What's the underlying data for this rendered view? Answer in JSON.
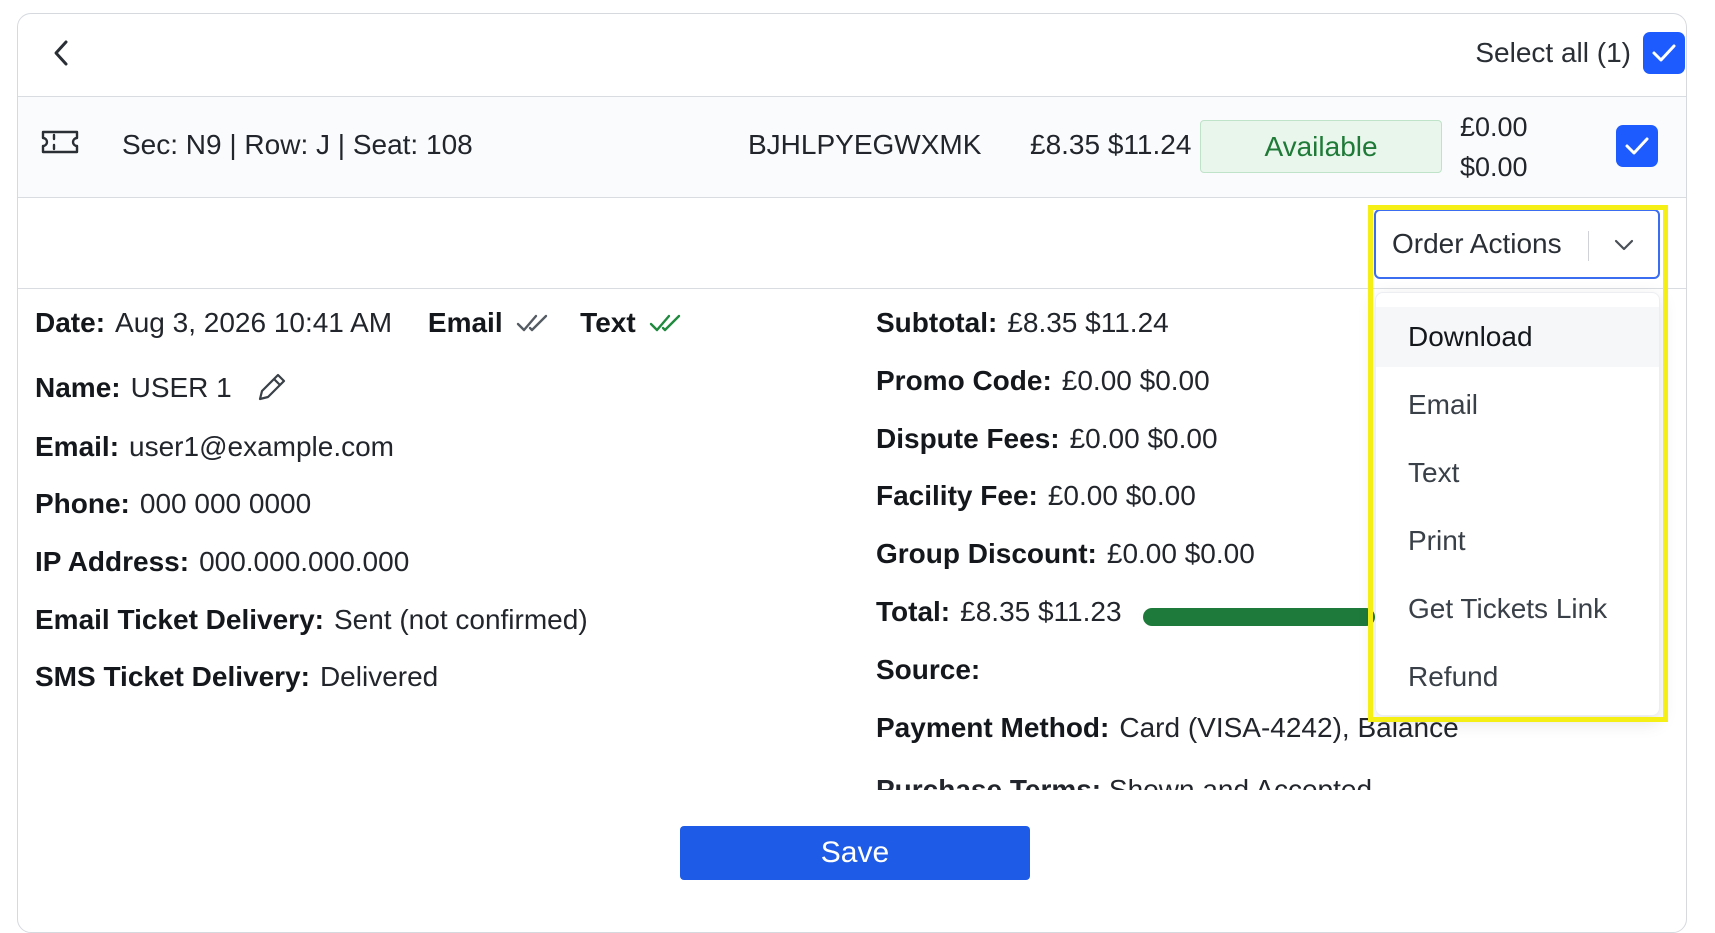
{
  "header": {
    "select_all_label": "Select all (1)"
  },
  "ticket": {
    "seat_info": "Sec: N9 | Row: J | Seat: 108",
    "order_code": "BJHLPYEGWXMK",
    "price": "£8.35 $11.24",
    "status": "Available",
    "fee_gbp": "£0.00",
    "fee_usd": "$0.00"
  },
  "order_actions": {
    "label": "Order Actions",
    "menu": [
      "Download",
      "Email",
      "Text",
      "Print",
      "Get Tickets Link",
      "Refund"
    ]
  },
  "details_left": {
    "date_label": "Date:",
    "date_value": "Aug 3, 2026 10:41 AM",
    "email_flag": "Email",
    "text_flag": "Text",
    "name_label": "Name:",
    "name_value": "USER 1",
    "email_label": "Email:",
    "email_value": "user1@example.com",
    "phone_label": "Phone:",
    "phone_value": "000 000 0000",
    "ip_label": "IP Address:",
    "ip_value": "000.000.000.000",
    "email_delivery_label": "Email Ticket Delivery:",
    "email_delivery_value": "Sent (not confirmed)",
    "sms_delivery_label": "SMS Ticket Delivery:",
    "sms_delivery_value": "Delivered"
  },
  "details_right": {
    "subtotal_label": "Subtotal:",
    "subtotal_value": "£8.35 $11.24",
    "promo_label": "Promo Code:",
    "promo_value": "£0.00 $0.00",
    "dispute_label": "Dispute Fees:",
    "dispute_value": "£0.00 $0.00",
    "facility_label": "Facility Fee:",
    "facility_value": "£0.00 $0.00",
    "group_label": "Group Discount:",
    "group_value": "£0.00 $0.00",
    "total_label": "Total:",
    "total_value": "£8.35 $11.23",
    "source_label": "Source:",
    "payment_label": "Payment Method:",
    "payment_value": "Card (VISA-4242), Balance",
    "terms_label": "Purchase Terms:",
    "terms_value": "Shown and Accepted"
  },
  "save_label": "Save",
  "colors": {
    "accent": "#1e5bff",
    "available_bg": "#e9f6ec",
    "available_text": "#1f7a38",
    "progress": "#1e7a3a",
    "highlight": "#f6ef16"
  }
}
